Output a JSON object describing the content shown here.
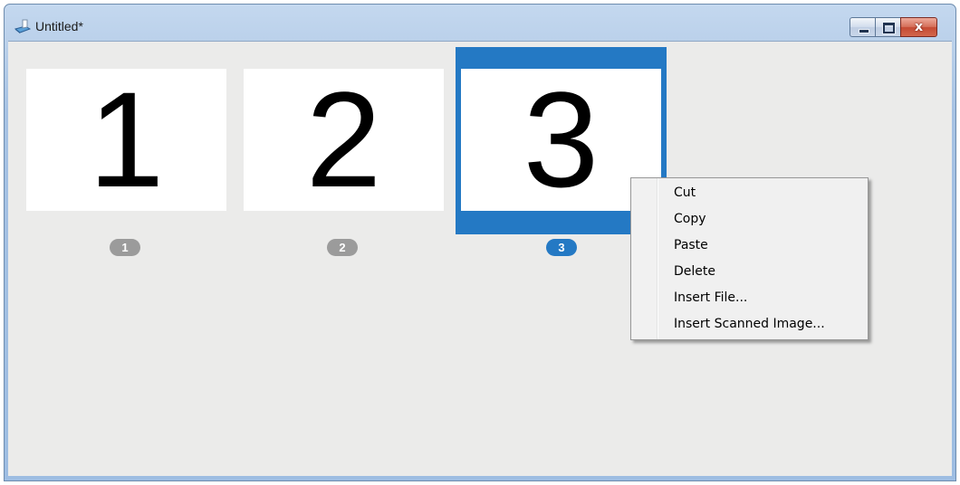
{
  "window": {
    "title": "Untitled*",
    "controls": {
      "minimize": "",
      "maximize": "",
      "close": "x"
    }
  },
  "pages": [
    {
      "thumb_text": "1",
      "badge": "1",
      "selected": false
    },
    {
      "thumb_text": "2",
      "badge": "2",
      "selected": false
    },
    {
      "thumb_text": "3",
      "badge": "3",
      "selected": true
    }
  ],
  "context_menu": {
    "items": [
      "Cut",
      "Copy",
      "Paste",
      "Delete",
      "Insert File...",
      "Insert Scanned Image..."
    ]
  },
  "colors": {
    "selection_accent": "#2479c4",
    "badge_default": "#9b9b9b",
    "client_background": "#ebebea"
  }
}
